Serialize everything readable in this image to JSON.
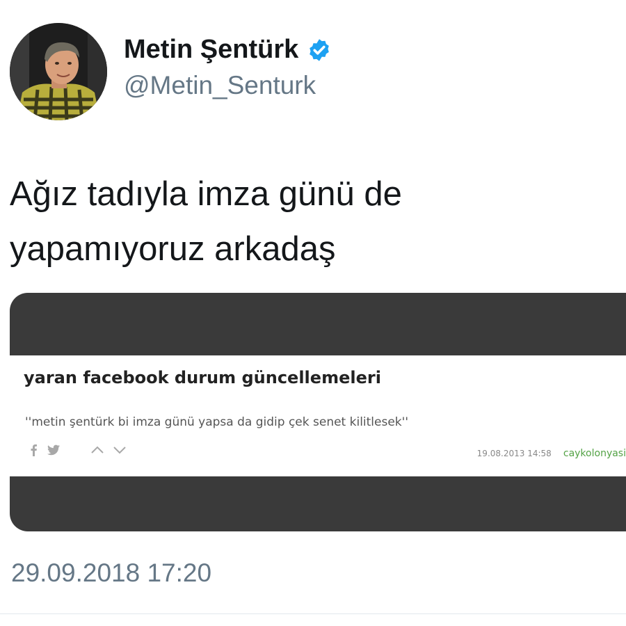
{
  "tweet": {
    "author": {
      "display_name": "Metin Şentürk",
      "handle": "@Metin_Senturk",
      "verified": true,
      "verified_color": "#1da1f2"
    },
    "text_lines": [
      "Ağız tadıyla imza günü de",
      "yapamıyoruz arkadaş"
    ],
    "timestamp": "29.09.2018 17:20"
  },
  "embedded_post": {
    "title": "yaran facebook durum güncellemeleri",
    "body": "''metin şentürk bi imza günü yapsa da gidip çek senet kilitlesek''",
    "date": "19.08.2013 14:58",
    "author": "caykolonyasi",
    "author_color": "#53a245",
    "icons": [
      "facebook-icon",
      "twitter-icon",
      "upvote-icon",
      "downvote-icon"
    ]
  },
  "colors": {
    "media_frame": "#3a3a3a",
    "secondary_text": "#657786"
  }
}
